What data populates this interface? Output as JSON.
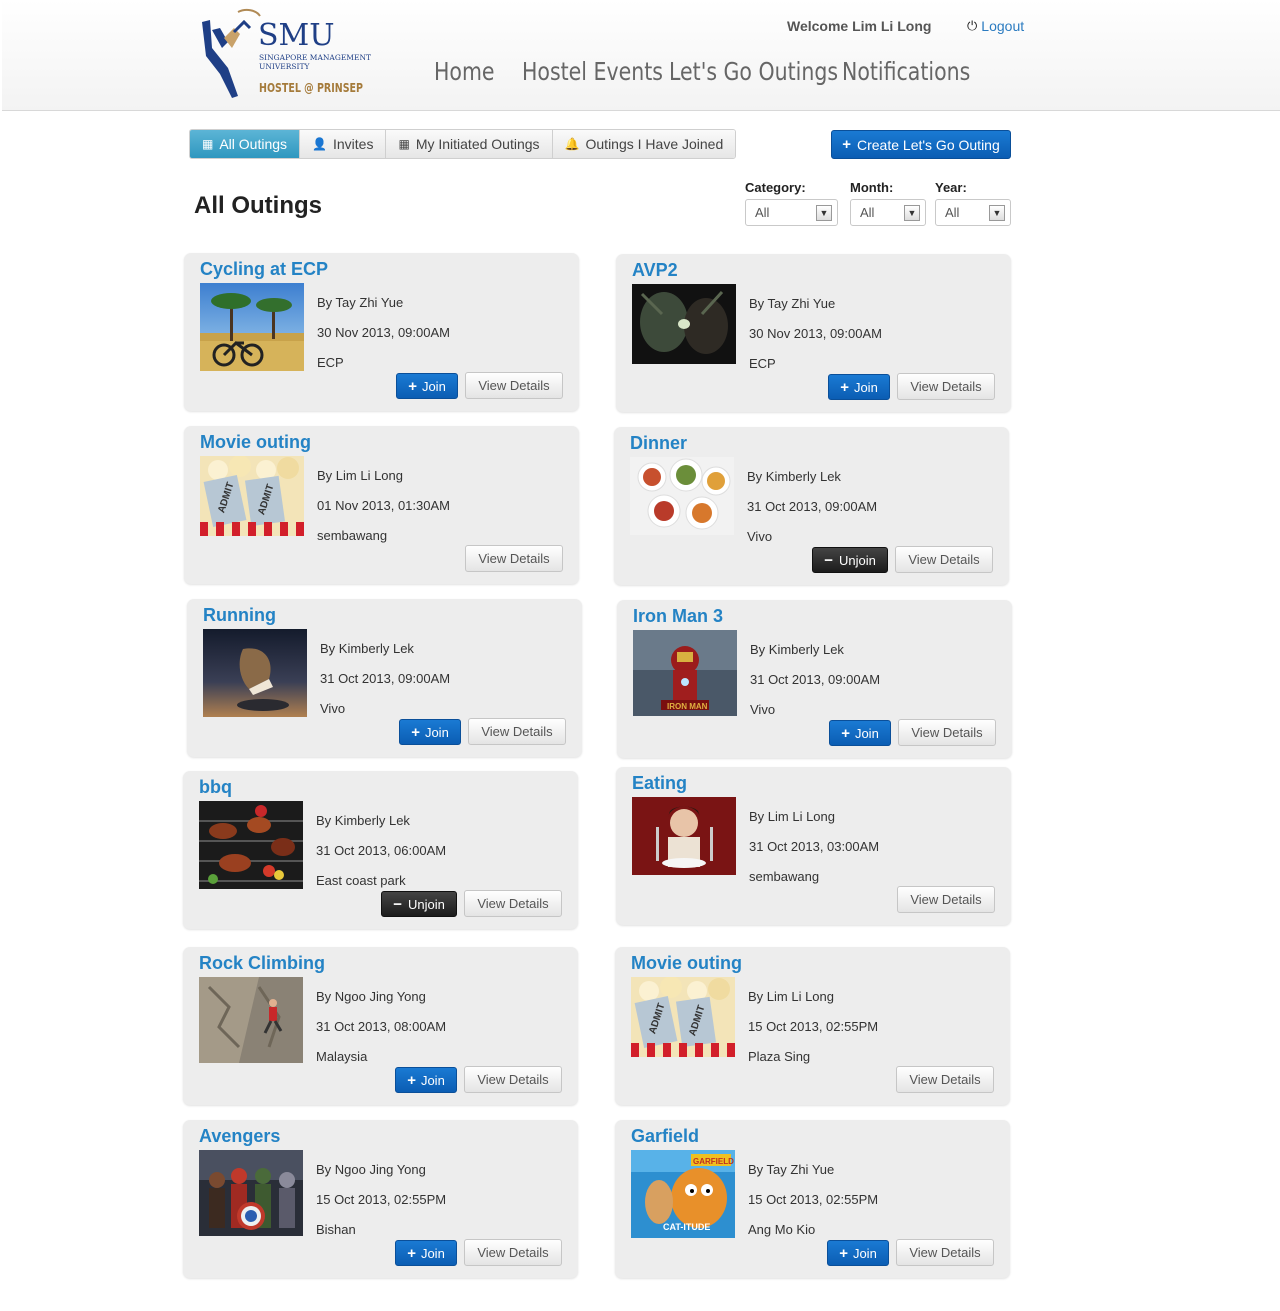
{
  "header": {
    "logo": {
      "wordmark": "SMU",
      "line1": "SINGAPORE MANAGEMENT",
      "line2": "UNIVERSITY",
      "line3": "HOSTEL @ PRINSEP"
    },
    "welcome": "Welcome Lim Li Long",
    "logout": "Logout",
    "nav": [
      "Home",
      "Hostel Events",
      "Let's Go Outings",
      "Notifications"
    ]
  },
  "tabs": [
    "All Outings",
    "Invites",
    "My Initiated Outings",
    "Outings I Have Joined"
  ],
  "create_button": "Create Let's Go Outing",
  "page_title": "All Outings",
  "filters": {
    "category": {
      "label": "Category:",
      "value": "All"
    },
    "month": {
      "label": "Month:",
      "value": "All"
    },
    "year": {
      "label": "Year:",
      "value": "All"
    }
  },
  "buttons": {
    "join": "Join",
    "unjoin": "Unjoin",
    "view": "View Details"
  },
  "outings": [
    {
      "title": "Cycling at ECP",
      "by": "By Tay Zhi Yue",
      "date": "30 Nov 2013, 09:00AM",
      "location": "ECP",
      "action": "join",
      "image": "cycling-photo"
    },
    {
      "title": "AVP2",
      "by": "By Tay Zhi Yue",
      "date": "30 Nov 2013, 09:00AM",
      "location": "ECP",
      "action": "join",
      "image": "avp2-poster"
    },
    {
      "title": "Movie outing",
      "by": "By Lim Li Long",
      "date": "01 Nov 2013, 01:30AM",
      "location": "sembawang",
      "action": "none",
      "image": "movie-tickets-photo"
    },
    {
      "title": "Dinner",
      "by": "By Kimberly Lek",
      "date": "31 Oct 2013, 09:00AM",
      "location": "Vivo",
      "action": "unjoin",
      "image": "dinner-photo"
    },
    {
      "title": "Running",
      "by": "By Kimberly Lek",
      "date": "31 Oct 2013, 09:00AM",
      "location": "Vivo",
      "action": "join",
      "image": "running-shoe-photo"
    },
    {
      "title": "Iron Man 3",
      "by": "By Kimberly Lek",
      "date": "31 Oct 2013, 09:00AM",
      "location": "Vivo",
      "action": "join",
      "image": "iron-man-poster"
    },
    {
      "title": "bbq",
      "by": "By Kimberly Lek",
      "date": "31 Oct 2013, 06:00AM",
      "location": "East coast park",
      "action": "unjoin",
      "image": "bbq-photo"
    },
    {
      "title": "Eating",
      "by": "By Lim Li Long",
      "date": "31 Oct 2013, 03:00AM",
      "location": "sembawang",
      "action": "none",
      "image": "eating-photo"
    },
    {
      "title": "Rock Climbing",
      "by": "By Ngoo Jing Yong",
      "date": "31 Oct 2013, 08:00AM",
      "location": "Malaysia",
      "action": "join",
      "image": "rock-climbing-photo"
    },
    {
      "title": "Movie outing",
      "by": "By Lim Li Long",
      "date": "15 Oct 2013, 02:55PM",
      "location": "Plaza Sing",
      "action": "none",
      "image": "movie-tickets-photo"
    },
    {
      "title": "Avengers",
      "by": "By Ngoo Jing Yong",
      "date": "15 Oct 2013, 02:55PM",
      "location": "Bishan",
      "action": "join",
      "image": "avengers-poster"
    },
    {
      "title": "Garfield",
      "by": "By Tay Zhi Yue",
      "date": "15 Oct 2013, 02:55PM",
      "location": "Ang Mo Kio",
      "action": "join",
      "image": "garfield-poster"
    }
  ],
  "colors": {
    "link": "#2483c5",
    "primary": "#0b5db3",
    "active_tab": "#2f97bf",
    "card": "#ededed",
    "unjoin": "#1c1c1c"
  }
}
